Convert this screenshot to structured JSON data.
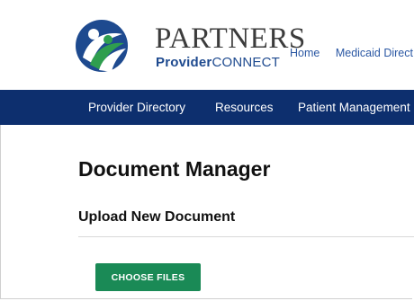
{
  "header": {
    "brand_name": "PARTNERS",
    "brand_sub_bold": "Provider",
    "brand_sub_regular": "CONNECT",
    "top_links": [
      "Home",
      "Medicaid Direct"
    ]
  },
  "nav": {
    "items": [
      "Provider Directory",
      "Resources",
      "Patient Management"
    ]
  },
  "main": {
    "page_title": "Document Manager",
    "section_title": "Upload New Document",
    "choose_files_label": "CHOOSE FILES"
  },
  "colors": {
    "navbar": "#0d2f6e",
    "button": "#1a8a56",
    "link": "#2a57a3",
    "brand_blue": "#1e4a8f",
    "brand_green": "#2f9e4f"
  }
}
